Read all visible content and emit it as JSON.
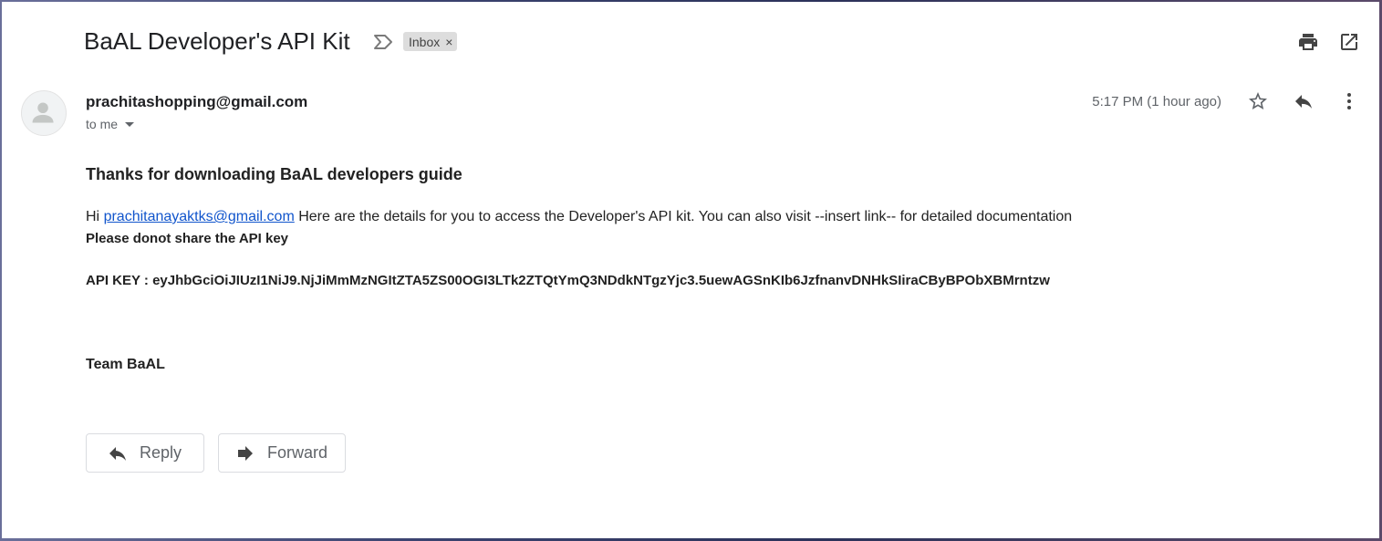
{
  "email": {
    "subject": "BaAL Developer's API Kit",
    "label": "Inbox",
    "label_remove": "×",
    "sender": "prachitashopping@gmail.com",
    "recipient_text": "to me",
    "time": "5:17 PM (1 hour ago)"
  },
  "body": {
    "heading": "Thanks for downloading BaAL developers guide",
    "greeting_prefix": "Hi ",
    "greeting_email": "prachitanayaktks@gmail.com",
    "greeting_rest": " Here are the details for you to access the Developer's API kit. You can also visit --insert link-- for detailed documentation",
    "warning": "Please donot share the API key",
    "api_key": "API KEY : eyJhbGciOiJIUzI1NiJ9.NjJiMmMzNGItZTA5ZS00OGI3LTk2ZTQtYmQ3NDdkNTgzYjc3.5uewAGSnKIb6JzfnanvDNHkSIiraCByBPObXBMrntzw",
    "signature": "Team BaAL"
  },
  "actions": {
    "reply": "Reply",
    "forward": "Forward"
  },
  "icons": {
    "important": "important-marker-icon",
    "print": "print-icon",
    "open_new": "open-in-new-window-icon",
    "star": "star-icon",
    "reply": "reply-icon",
    "more": "more-vert-icon",
    "forward": "forward-icon",
    "avatar": "default-avatar-icon"
  },
  "colors": {
    "link": "#1155cc",
    "label_bg": "#dddddd",
    "icon": "#5f6368"
  }
}
